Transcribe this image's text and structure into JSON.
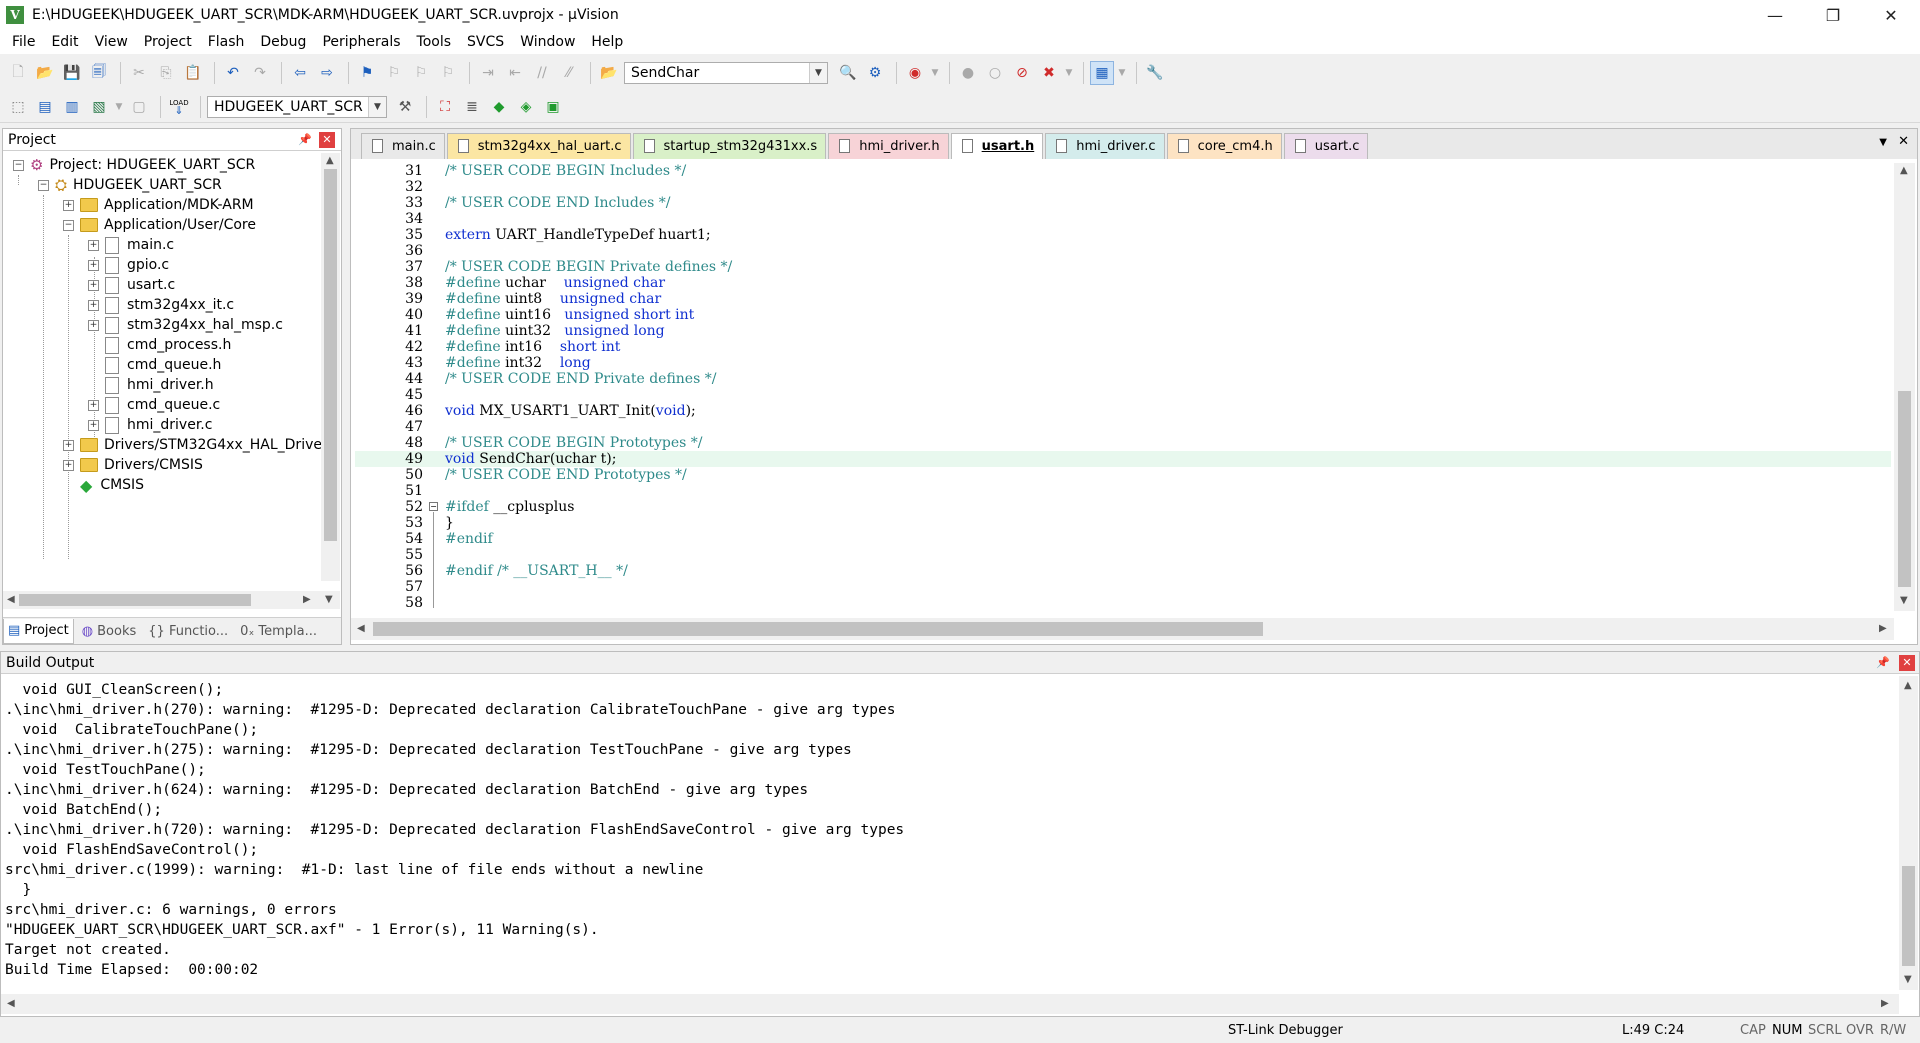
{
  "window": {
    "title": "E:\\HDUGEEK\\HDUGEEK_UART_SCR\\MDK-ARM\\HDUGEEK_UART_SCR.uvprojx - µVision",
    "app_icon": "V",
    "minimize_glyph": "—",
    "maximize_glyph": "❐",
    "close_glyph": "✕"
  },
  "menu": [
    "File",
    "Edit",
    "View",
    "Project",
    "Flash",
    "Debug",
    "Peripherals",
    "Tools",
    "SVCS",
    "Window",
    "Help"
  ],
  "toolbar": {
    "find_combo_value": "SendChar",
    "target_combo_value": "HDUGEEK_UART_SCR",
    "load_label": "LOAD"
  },
  "project_panel": {
    "title": "Project",
    "tree": [
      {
        "label": "Project: HDUGEEK_UART_SCR"
      },
      {
        "label": "HDUGEEK_UART_SCR"
      },
      {
        "label": "Application/MDK-ARM"
      },
      {
        "label": "Application/User/Core"
      },
      {
        "label": "main.c"
      },
      {
        "label": "gpio.c"
      },
      {
        "label": "usart.c"
      },
      {
        "label": "stm32g4xx_it.c"
      },
      {
        "label": "stm32g4xx_hal_msp.c"
      },
      {
        "label": "cmd_process.h"
      },
      {
        "label": "cmd_queue.h"
      },
      {
        "label": "hmi_driver.h"
      },
      {
        "label": "cmd_queue.c"
      },
      {
        "label": "hmi_driver.c"
      },
      {
        "label": "Drivers/STM32G4xx_HAL_Driver"
      },
      {
        "label": "Drivers/CMSIS"
      },
      {
        "label": "CMSIS"
      }
    ],
    "bottom_tabs": [
      "Project",
      "Books",
      "{} Functio...",
      "0ₓ Templa..."
    ]
  },
  "editor": {
    "tabs": [
      {
        "label": "main.c",
        "color": "#e9e9e9"
      },
      {
        "label": "stm32g4xx_hal_uart.c",
        "color": "#fbe6a3"
      },
      {
        "label": "startup_stm32g431xx.s",
        "color": "#d9f0c8"
      },
      {
        "label": "hmi_driver.h",
        "color": "#f7d3d7"
      },
      {
        "label": "usart.h",
        "color": "#ffffff"
      },
      {
        "label": "hmi_driver.c",
        "color": "#d4ecec"
      },
      {
        "label": "core_cm4.h",
        "color": "#fde3c3"
      },
      {
        "label": "usart.c",
        "color": "#ecdcec"
      }
    ],
    "active_tab": "usart.h",
    "highlight_line": "49",
    "lines": [
      {
        "n": "31",
        "parts": [
          {
            "t": "/* USER CODE BEGIN Includes */",
            "c": "cmt"
          }
        ]
      },
      {
        "n": "32",
        "parts": []
      },
      {
        "n": "33",
        "parts": [
          {
            "t": "/* USER CODE END Includes */",
            "c": "cmt"
          }
        ]
      },
      {
        "n": "34",
        "parts": []
      },
      {
        "n": "35",
        "parts": [
          {
            "t": "extern",
            "c": "kw"
          },
          {
            "t": " UART_HandleTypeDef huart1;",
            "c": ""
          }
        ]
      },
      {
        "n": "36",
        "parts": []
      },
      {
        "n": "37",
        "parts": [
          {
            "t": "/* USER CODE BEGIN Private defines */",
            "c": "cmt"
          }
        ]
      },
      {
        "n": "38",
        "parts": [
          {
            "t": "#define",
            "c": "pp"
          },
          {
            "t": " uchar    ",
            "c": ""
          },
          {
            "t": "unsigned char",
            "c": "kw"
          }
        ]
      },
      {
        "n": "39",
        "parts": [
          {
            "t": "#define",
            "c": "pp"
          },
          {
            "t": " uint8    ",
            "c": ""
          },
          {
            "t": "unsigned char",
            "c": "kw"
          }
        ]
      },
      {
        "n": "40",
        "parts": [
          {
            "t": "#define",
            "c": "pp"
          },
          {
            "t": " uint16   ",
            "c": ""
          },
          {
            "t": "unsigned short int",
            "c": "kw"
          }
        ]
      },
      {
        "n": "41",
        "parts": [
          {
            "t": "#define",
            "c": "pp"
          },
          {
            "t": " uint32   ",
            "c": ""
          },
          {
            "t": "unsigned long",
            "c": "kw"
          }
        ]
      },
      {
        "n": "42",
        "parts": [
          {
            "t": "#define",
            "c": "pp"
          },
          {
            "t": " int16    ",
            "c": ""
          },
          {
            "t": "short int",
            "c": "kw"
          }
        ]
      },
      {
        "n": "43",
        "parts": [
          {
            "t": "#define",
            "c": "pp"
          },
          {
            "t": " int32    ",
            "c": ""
          },
          {
            "t": "long",
            "c": "kw"
          }
        ]
      },
      {
        "n": "44",
        "parts": [
          {
            "t": "/* USER CODE END Private defines */",
            "c": "cmt"
          }
        ]
      },
      {
        "n": "45",
        "parts": []
      },
      {
        "n": "46",
        "parts": [
          {
            "t": "void",
            "c": "kw"
          },
          {
            "t": " MX_USART1_UART_Init(",
            "c": ""
          },
          {
            "t": "void",
            "c": "kw"
          },
          {
            "t": ");",
            "c": ""
          }
        ]
      },
      {
        "n": "47",
        "parts": []
      },
      {
        "n": "48",
        "parts": [
          {
            "t": "/* USER CODE BEGIN Prototypes */",
            "c": "cmt"
          }
        ]
      },
      {
        "n": "49",
        "parts": [
          {
            "t": "void",
            "c": "kw"
          },
          {
            "t": " SendChar(uchar t);",
            "c": ""
          }
        ]
      },
      {
        "n": "50",
        "parts": [
          {
            "t": "/* USER CODE END Prototypes */",
            "c": "cmt"
          }
        ]
      },
      {
        "n": "51",
        "parts": []
      },
      {
        "n": "52",
        "parts": [
          {
            "t": "#ifdef",
            "c": "pp"
          },
          {
            "t": " __cplusplus",
            "c": ""
          }
        ]
      },
      {
        "n": "53",
        "parts": [
          {
            "t": "}",
            "c": ""
          }
        ]
      },
      {
        "n": "54",
        "parts": [
          {
            "t": "#endif",
            "c": "pp"
          }
        ]
      },
      {
        "n": "55",
        "parts": []
      },
      {
        "n": "56",
        "parts": [
          {
            "t": "#endif",
            "c": "pp"
          },
          {
            "t": " /* __USART_H__ */",
            "c": "cmt"
          }
        ]
      },
      {
        "n": "57",
        "parts": []
      },
      {
        "n": "58",
        "parts": []
      }
    ]
  },
  "build_output": {
    "title": "Build Output",
    "lines": [
      "  void GUI_CleanScreen();",
      ".\\inc\\hmi_driver.h(270): warning:  #1295-D: Deprecated declaration CalibrateTouchPane - give arg types",
      "  void  CalibrateTouchPane();",
      ".\\inc\\hmi_driver.h(275): warning:  #1295-D: Deprecated declaration TestTouchPane - give arg types",
      "  void TestTouchPane();",
      ".\\inc\\hmi_driver.h(624): warning:  #1295-D: Deprecated declaration BatchEnd - give arg types",
      "  void BatchEnd();",
      ".\\inc\\hmi_driver.h(720): warning:  #1295-D: Deprecated declaration FlashEndSaveControl - give arg types",
      "  void FlashEndSaveControl();",
      "src\\hmi_driver.c(1999): warning:  #1-D: last line of file ends without a newline",
      "  }",
      "src\\hmi_driver.c: 6 warnings, 0 errors",
      "\"HDUGEEK_UART_SCR\\HDUGEEK_UART_SCR.axf\" - 1 Error(s), 11 Warning(s).",
      "Target not created.",
      "Build Time Elapsed:  00:00:02"
    ]
  },
  "status": {
    "debugger": "ST-Link Debugger",
    "position": "L:49 C:24",
    "cap": "CAP",
    "num": "NUM",
    "scrl": "SCRL",
    "ovr": "OVR",
    "rw": "R/W"
  },
  "colors": {
    "keyword": "#1030d0",
    "comment": "#2e8a8a",
    "highlight": "#e8f8ee"
  }
}
